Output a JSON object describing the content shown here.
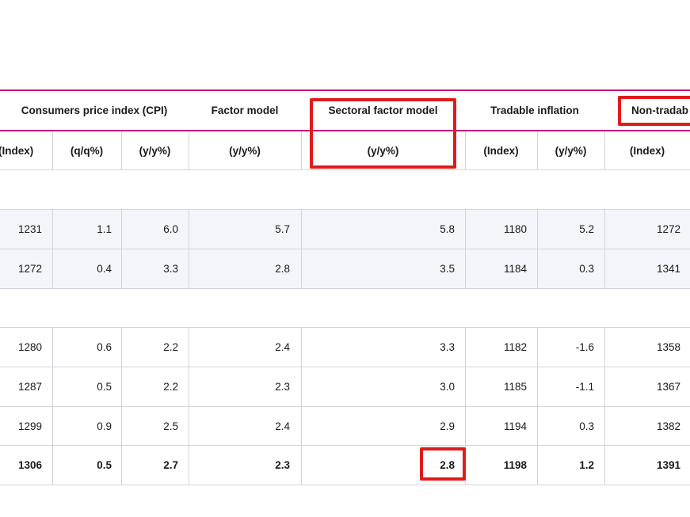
{
  "table": {
    "group_headers": {
      "cpi": "Consumers price index (CPI)",
      "factor": "Factor model",
      "sectoral": "Sectoral factor model",
      "tradable": "Tradable inflation",
      "nontradable": "Non-tradab"
    },
    "sub_headers": [
      "(Index)",
      "(q/q%)",
      "(y/y%)",
      "(y/y%)",
      "(y/y%)",
      "(Index)",
      "(y/y%)",
      "(Index)"
    ],
    "rows": [
      [
        "1231",
        "1.1",
        "6.0",
        "5.7",
        "5.8",
        "1180",
        "5.2",
        "1272"
      ],
      [
        "1272",
        "0.4",
        "3.3",
        "2.8",
        "3.5",
        "1184",
        "0.3",
        "1341"
      ],
      [
        "1280",
        "0.6",
        "2.2",
        "2.4",
        "3.3",
        "1182",
        "-1.6",
        "1358"
      ],
      [
        "1287",
        "0.5",
        "2.2",
        "2.3",
        "3.0",
        "1185",
        "-1.1",
        "1367"
      ],
      [
        "1299",
        "0.9",
        "2.5",
        "2.4",
        "2.9",
        "1194",
        "0.3",
        "1382"
      ],
      [
        "1306",
        "0.5",
        "2.7",
        "2.3",
        "2.8",
        "1198",
        "1.2",
        "1391"
      ]
    ]
  },
  "colors": {
    "accent_line": "#c8167a",
    "highlight_box": "#e01b1b",
    "shaded_row": "#f4f5fa"
  }
}
